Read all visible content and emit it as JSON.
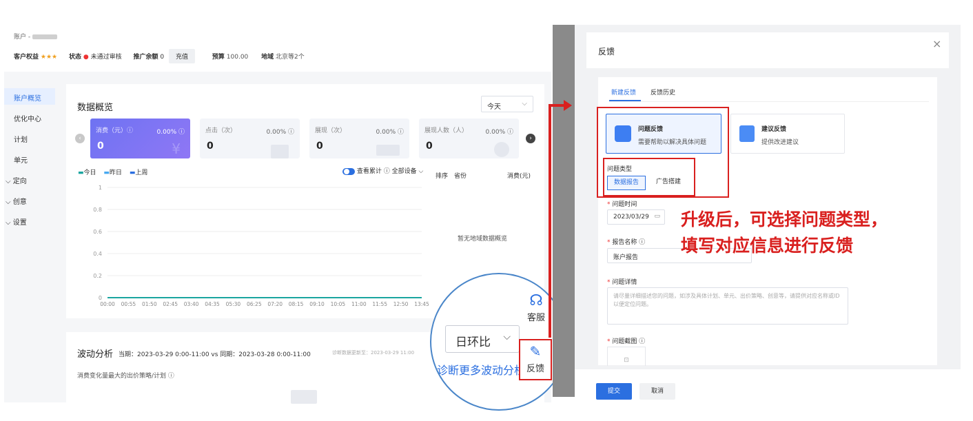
{
  "account": {
    "account_label": "账户 -",
    "rights_label": "客户权益",
    "stars": "★★★",
    "status_label": "状态",
    "status_value": "未通过审核",
    "balance_label": "推广余额",
    "balance_value": "0",
    "recharge_label": "充值",
    "budget_label": "预算",
    "budget_value": "100.00",
    "region_label": "地域",
    "region_value": "北京等2个"
  },
  "sidebar": {
    "items": [
      "账户概览",
      "优化中心",
      "计划",
      "单元",
      "定向",
      "创意",
      "设置"
    ]
  },
  "overview": {
    "title": "数据概览",
    "date_select": "今天",
    "metrics": [
      {
        "label": "消费（元）ⓘ",
        "pct": "0.00% ⓘ",
        "value": "0"
      },
      {
        "label": "点击（次）",
        "pct": "0.00% ⓘ",
        "value": "0"
      },
      {
        "label": "展现（次）",
        "pct": "0.00% ⓘ",
        "value": "0"
      },
      {
        "label": "展现人数（人）",
        "pct": "0.00% ⓘ",
        "value": "0"
      }
    ],
    "legend": [
      "今日",
      "昨日",
      "上周"
    ],
    "toggle_label": "查看累计 ⓘ",
    "device_label": "全部设备",
    "region_table": {
      "col1": "排序",
      "col2": "省份",
      "col3": "消费(元)",
      "empty": "暂无地域数据概览"
    }
  },
  "chart_data": {
    "type": "line",
    "x": [
      "00:00",
      "00:55",
      "01:50",
      "02:45",
      "03:40",
      "04:35",
      "05:30",
      "06:25",
      "07:20",
      "08:15",
      "09:10",
      "10:05",
      "11:00",
      "11:55",
      "12:50",
      "13:45"
    ],
    "yticks": [
      "1",
      "0.8",
      "0.6",
      "0.4",
      "0.2",
      "0"
    ],
    "ylim": [
      0,
      1
    ],
    "series": [
      {
        "name": "今日",
        "color": "#1aa5a0",
        "values": [
          0,
          0,
          0,
          0,
          0,
          0,
          0,
          0,
          0,
          0,
          0,
          0,
          0,
          0,
          0,
          0
        ]
      }
    ],
    "grid": true
  },
  "fluctuation": {
    "title": "波动分析",
    "period": "当期：2023-03-29 0:00-11:00 vs 同期：2023-03-28 0:00-11:00",
    "update_note": "诊断数据更新至：2023-03-29 11:00",
    "subtitle": "消费变化量最大的出价策略/计划 ⓘ"
  },
  "magnifier": {
    "select_value": "日环比",
    "service_label": "客服",
    "feedback_label": "反馈",
    "more_link": "诊断更多波动分析"
  },
  "feedback_dialog": {
    "title": "反馈",
    "close": "×",
    "tabs": [
      "新建反馈",
      "反馈历史"
    ],
    "option1_title": "问题反馈",
    "option1_desc": "需要帮助以解决具体问题",
    "option2_title": "建议反馈",
    "option2_desc": "提供改进建议",
    "type_label": "问题类型",
    "type_options": [
      "数据报告",
      "广告搭建"
    ],
    "time_label": "问题时间",
    "time_value": "2023/03/29",
    "report_label": "报告名称 ⓘ",
    "report_value": "账户报告",
    "detail_label": "问题详情",
    "detail_placeholder": "请尽量详细描述您的问题，如涉及具体计划、单元、出价策略、创意等，请提供对应名称或ID以便定位问题。",
    "screenshot_label": "问题截图 ⓘ",
    "submit": "提交",
    "cancel": "取消"
  },
  "annotation": {
    "line1": "升级后，可选择问题类型，",
    "line2": "填写对应信息进行反馈"
  },
  "colors": {
    "primary": "#2b6fe0",
    "accent_red": "#d9201f",
    "metric_purple": "#7b74f3"
  }
}
